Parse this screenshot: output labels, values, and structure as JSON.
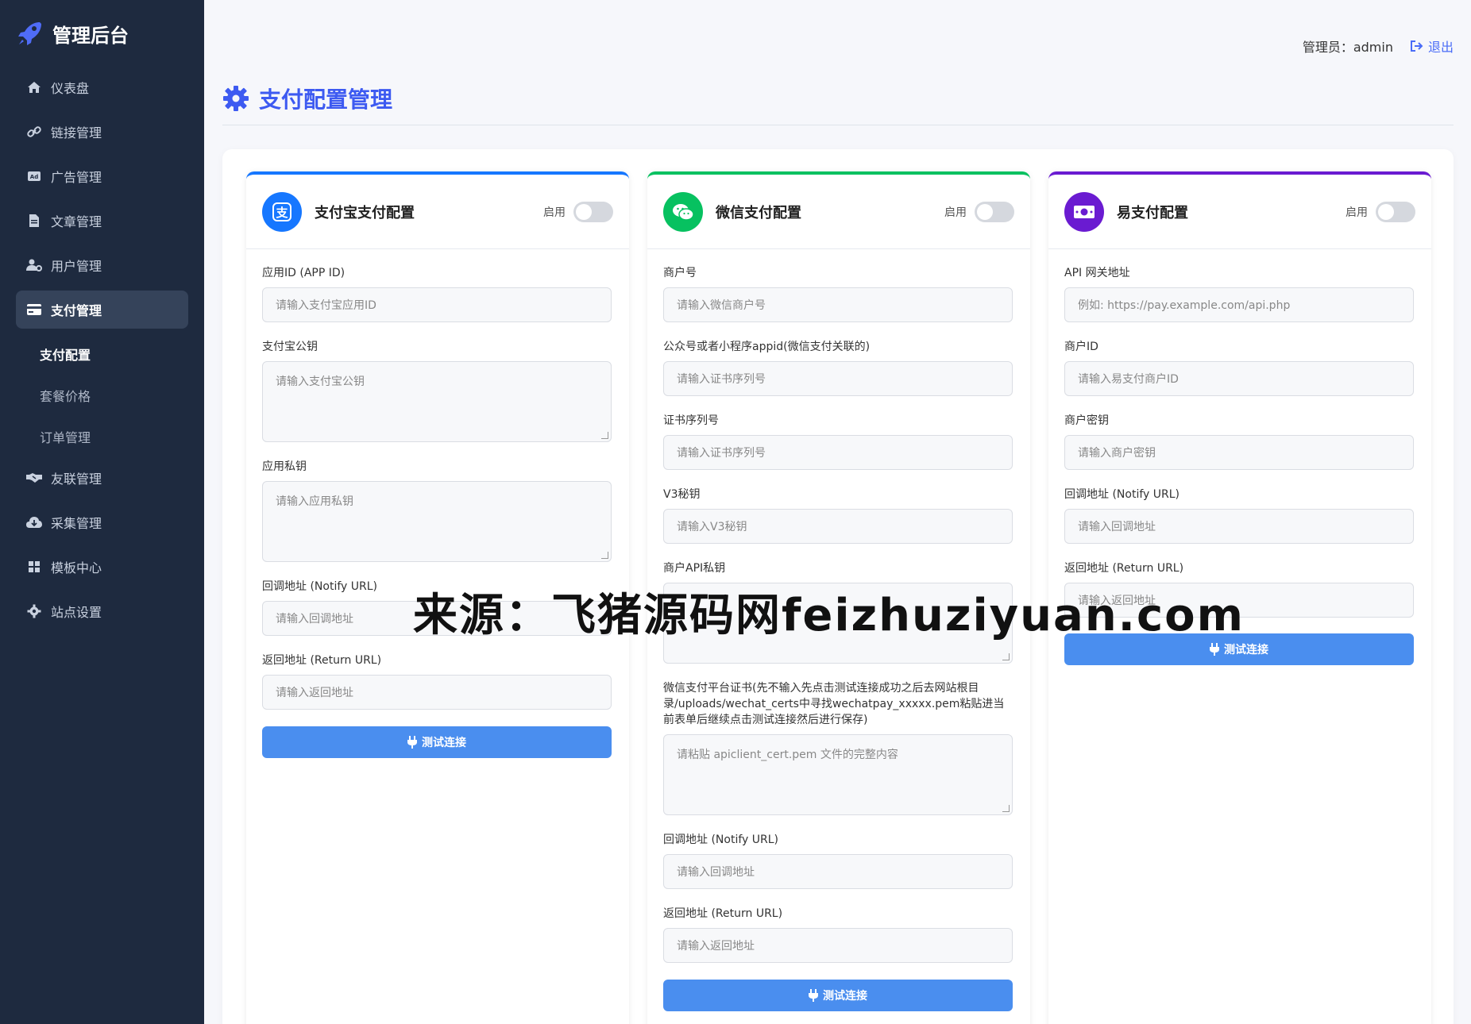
{
  "brand": {
    "title": "管理后台"
  },
  "nav": {
    "items": [
      {
        "label": "仪表盘",
        "icon": "home-icon"
      },
      {
        "label": "链接管理",
        "icon": "link-icon"
      },
      {
        "label": "广告管理",
        "icon": "ad-icon"
      },
      {
        "label": "文章管理",
        "icon": "file-icon"
      },
      {
        "label": "用户管理",
        "icon": "user-gear-icon"
      },
      {
        "label": "支付管理",
        "icon": "credit-card-icon"
      }
    ],
    "sub_items": [
      {
        "label": "支付配置"
      },
      {
        "label": "套餐价格"
      },
      {
        "label": "订单管理"
      }
    ],
    "items_after": [
      {
        "label": "友联管理",
        "icon": "handshake-icon"
      },
      {
        "label": "采集管理",
        "icon": "cloud-download-icon"
      },
      {
        "label": "模板中心",
        "icon": "grid-icon"
      },
      {
        "label": "站点设置",
        "icon": "gear-icon"
      }
    ]
  },
  "topbar": {
    "admin": "管理员：admin",
    "logout": "退出"
  },
  "page": {
    "title": "支付配置管理"
  },
  "cards": {
    "alipay": {
      "title": "支付宝支付配置",
      "toggle_label": "启用",
      "color": "#1677ff",
      "fields": [
        {
          "label": "应用ID (APP ID)",
          "placeholder": "请输入支付宝应用ID"
        },
        {
          "label": "支付宝公钥",
          "placeholder": "请输入支付宝公钥"
        },
        {
          "label": "应用私钥",
          "placeholder": "请输入应用私钥"
        },
        {
          "label": "回调地址 (Notify URL)",
          "placeholder": "请输入回调地址"
        },
        {
          "label": "返回地址 (Return URL)",
          "placeholder": "请输入返回地址"
        }
      ],
      "button": "测试连接"
    },
    "wechat": {
      "title": "微信支付配置",
      "toggle_label": "启用",
      "color": "#07c160",
      "fields": [
        {
          "label": "商户号",
          "placeholder": "请输入微信商户号"
        },
        {
          "label": "公众号或者小程序appid(微信支付关联的)",
          "placeholder": "请输入证书序列号"
        },
        {
          "label": "证书序列号",
          "placeholder": "请输入证书序列号"
        },
        {
          "label": "V3秘钥",
          "placeholder": "请输入V3秘钥"
        },
        {
          "label": "商户API私钥",
          "placeholder": ""
        },
        {
          "label": "微信支付平台证书(先不输入先点击测试连接成功之后去网站根目录/uploads/wechat_certs中寻找wechatpay_xxxxx.pem粘贴进当前表单后继续点击测试连接然后进行保存)",
          "placeholder": "请粘贴 apiclient_cert.pem 文件的完整内容"
        },
        {
          "label": "回调地址 (Notify URL)",
          "placeholder": "请输入回调地址"
        },
        {
          "label": "返回地址 (Return URL)",
          "placeholder": "请输入返回地址"
        }
      ],
      "button": "测试连接"
    },
    "epay": {
      "title": "易支付配置",
      "toggle_label": "启用",
      "color": "#6a1bd1",
      "fields": [
        {
          "label": "API 网关地址",
          "placeholder": "例如: https://pay.example.com/api.php"
        },
        {
          "label": "商户ID",
          "placeholder": "请输入易支付商户ID"
        },
        {
          "label": "商户密钥",
          "placeholder": "请输入商户密钥"
        },
        {
          "label": "回调地址 (Notify URL)",
          "placeholder": "请输入回调地址"
        },
        {
          "label": "返回地址 (Return URL)",
          "placeholder": "请输入返回地址"
        }
      ],
      "button": "测试连接"
    }
  },
  "watermark": "来源：飞猪源码网feizhuziyuan.com"
}
